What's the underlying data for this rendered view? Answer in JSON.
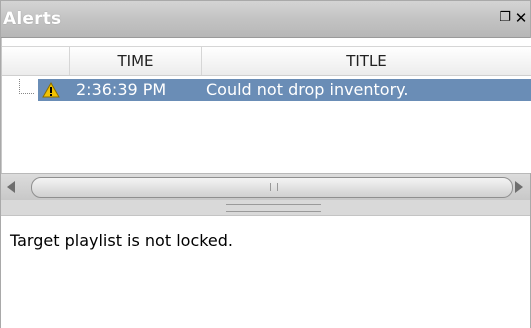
{
  "panel": {
    "title": "Alerts",
    "restore_icon": "restore-window-icon",
    "close_icon": "close-icon"
  },
  "columns": {
    "blank": "",
    "time": "TIME",
    "title": "TITLE"
  },
  "alerts": [
    {
      "severity": "warning",
      "time": "2:36:39 PM",
      "title": "Could not drop inventory."
    }
  ],
  "detail": {
    "text": "Target playlist is not locked."
  },
  "colors": {
    "selection": "#6a8db6",
    "warning": "#f2c200"
  }
}
